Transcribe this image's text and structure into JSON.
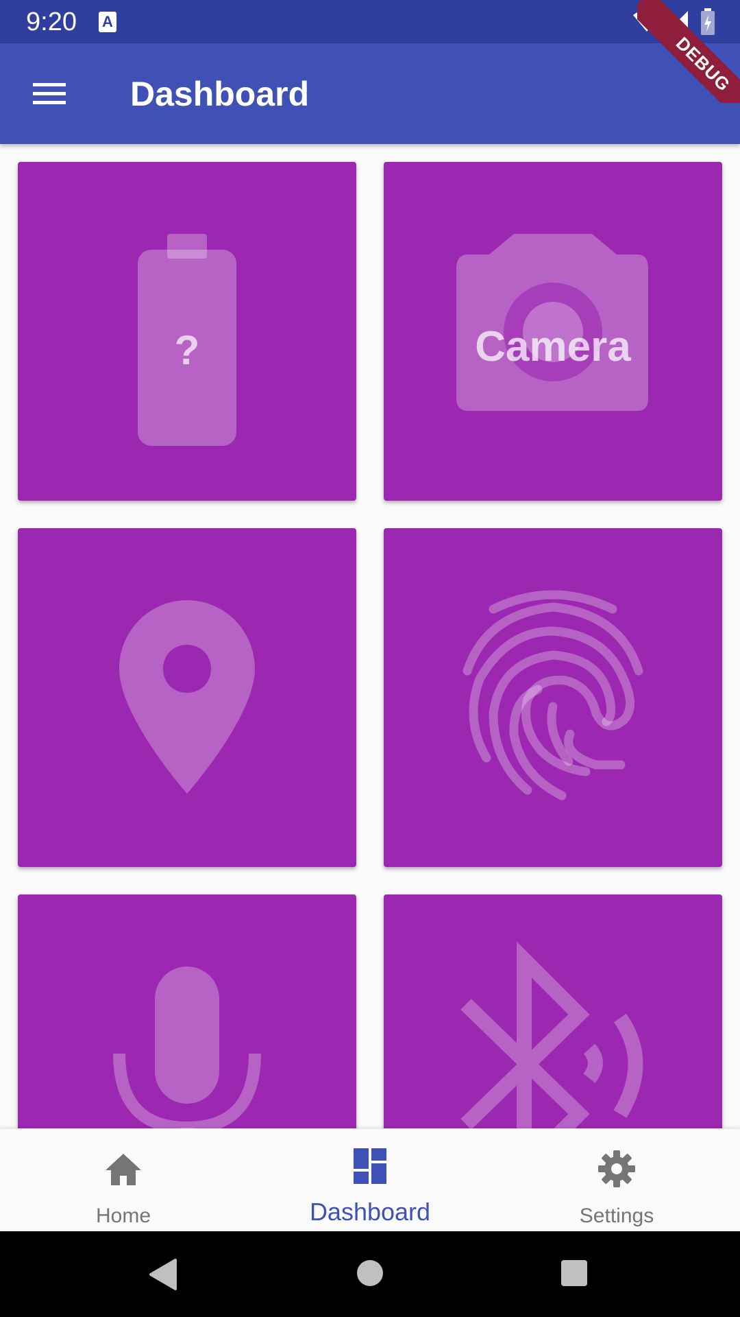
{
  "status_bar": {
    "time": "9:20",
    "notification_glyph": "A",
    "icons": [
      "wifi-icon",
      "signal-icon",
      "battery-icon"
    ],
    "debug_label": "DEBUG"
  },
  "app_bar": {
    "title": "Dashboard",
    "menu_icon": "menu-icon",
    "color": "#3f51b5"
  },
  "tiles": [
    {
      "icon": "battery-unknown-icon",
      "label": "?"
    },
    {
      "icon": "camera-icon",
      "label": "Camera"
    },
    {
      "icon": "location-pin-icon",
      "label": ""
    },
    {
      "icon": "fingerprint-icon",
      "label": ""
    },
    {
      "icon": "microphone-icon",
      "label": ""
    },
    {
      "icon": "bluetooth-searching-icon",
      "label": ""
    }
  ],
  "tile_color": "#9c27b0",
  "bottom_nav": {
    "items": [
      {
        "label": "Home",
        "icon": "home-icon",
        "active": false
      },
      {
        "label": "Dashboard",
        "icon": "dashboard-icon",
        "active": true
      },
      {
        "label": "Settings",
        "icon": "settings-gear-icon",
        "active": false
      }
    ],
    "active_color": "#3f51b5",
    "inactive_color": "#757575"
  },
  "system_nav": {
    "buttons": [
      "back-icon",
      "home-circle-icon",
      "recents-icon"
    ]
  }
}
